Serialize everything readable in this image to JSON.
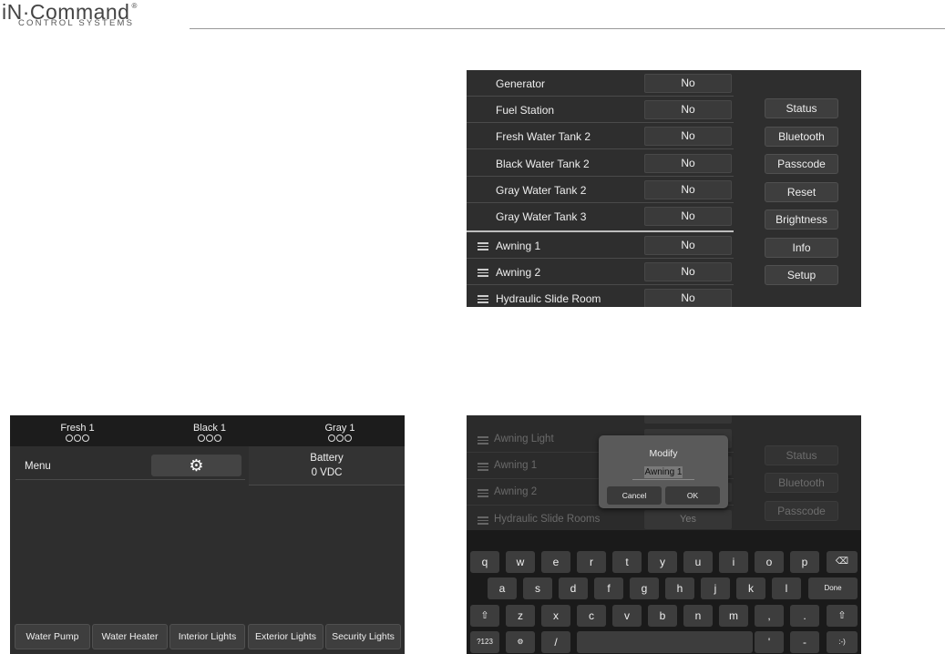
{
  "header": {
    "logo_text": "iN·Command",
    "logo_mark": "®",
    "logo_sub": "CONTROL SYSTEMS"
  },
  "settings_screen": {
    "rows": [
      {
        "label": "Generator",
        "value": "No"
      },
      {
        "label": "Fuel Station",
        "value": "No"
      },
      {
        "label": "Fresh Water Tank 2",
        "value": "No"
      },
      {
        "label": "Black Water Tank 2",
        "value": "No"
      },
      {
        "label": "Gray Water Tank 2",
        "value": "No"
      },
      {
        "label": "Gray Water Tank 3",
        "value": "No"
      },
      {
        "label": "Awning 1",
        "value": "No"
      },
      {
        "label": "Awning 2",
        "value": "No"
      },
      {
        "label": "Hydraulic Slide Room",
        "value": "No"
      }
    ],
    "side_buttons": [
      "Status",
      "Bluetooth",
      "Passcode",
      "Reset",
      "Brightness",
      "Info",
      "Setup"
    ]
  },
  "main_screen": {
    "tanks": [
      {
        "label": "Fresh 1"
      },
      {
        "label": "Black 1"
      },
      {
        "label": "Gray 1"
      }
    ],
    "menu_label": "Menu",
    "battery_label": "Battery",
    "battery_value": "0 VDC",
    "footer_buttons": [
      "Water Pump",
      "Water Heater",
      "Interior Lights",
      "Exterior Lights",
      "Security Lights"
    ]
  },
  "keyboard_screen": {
    "rows": [
      {
        "label": "Awning Light",
        "value": ""
      },
      {
        "label": "Awning 1",
        "value": ""
      },
      {
        "label": "Awning 2",
        "value": ""
      },
      {
        "label": "Hydraulic Slide Rooms",
        "value": "Yes"
      }
    ],
    "side_buttons": [
      "Status",
      "Bluetooth",
      "Passcode"
    ],
    "dialog": {
      "title": "Modify",
      "input_value": "Awning 1",
      "cancel_label": "Cancel",
      "ok_label": "OK"
    },
    "keys_row1": [
      "q",
      "w",
      "e",
      "r",
      "t",
      "y",
      "u",
      "i",
      "o",
      "p"
    ],
    "keys_row2": [
      "a",
      "s",
      "d",
      "f",
      "g",
      "h",
      "j",
      "k",
      "l"
    ],
    "keys_row3": [
      "z",
      "x",
      "c",
      "v",
      "b",
      "n",
      "m",
      ",",
      "."
    ],
    "done_label": "Done",
    "sym_label": "?123",
    "slash_label": "/",
    "apos_label": "'",
    "dash_label": "-",
    "smiley_label": ":-)"
  }
}
